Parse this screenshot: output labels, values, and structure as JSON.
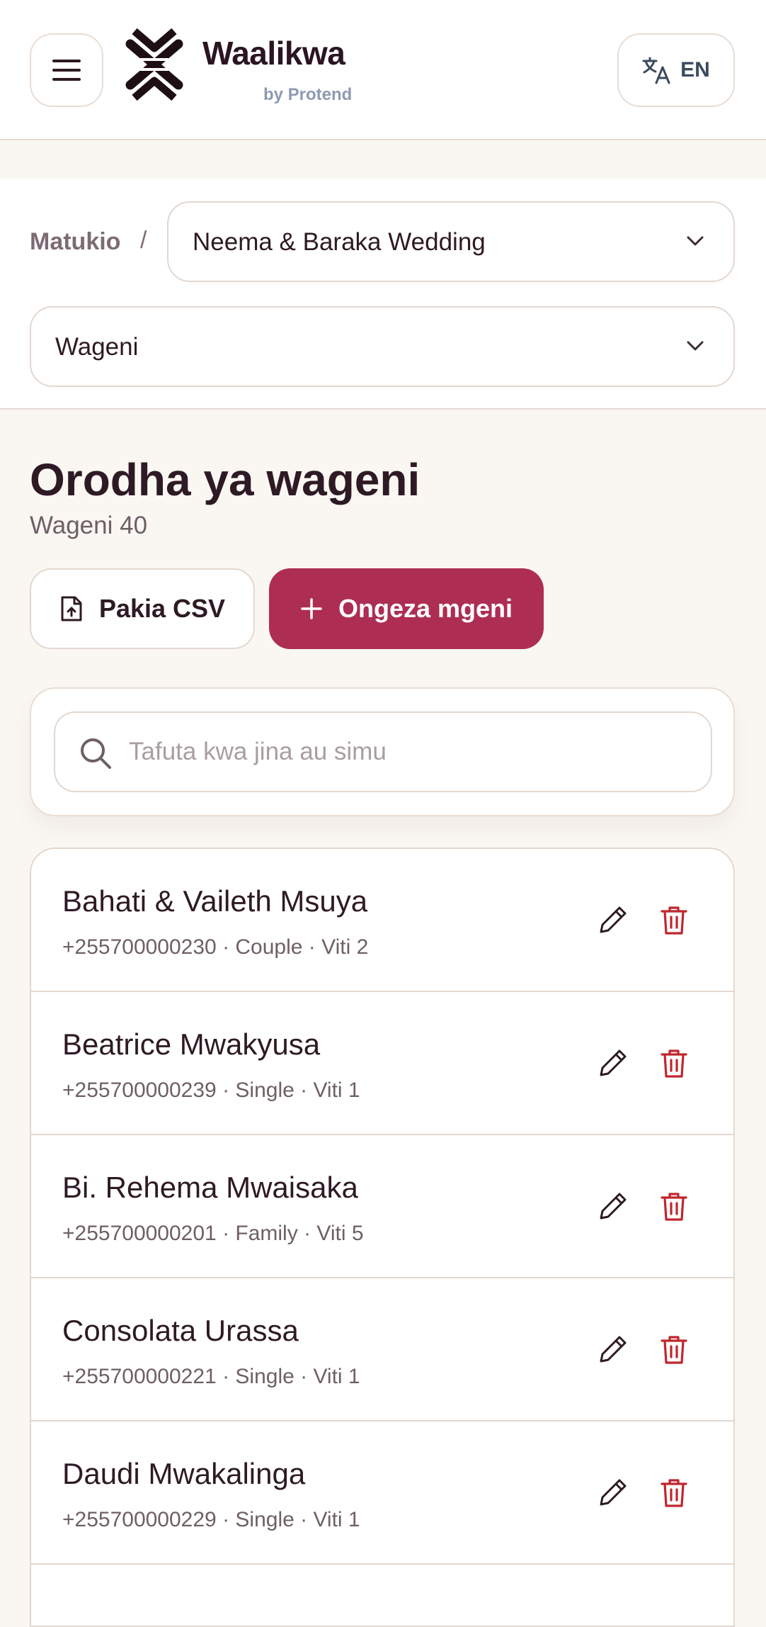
{
  "header": {
    "brand_name": "Waalikwa",
    "brand_sub": "by Protend",
    "language": "EN"
  },
  "breadcrumb": {
    "root": "Matukio",
    "separator": "/",
    "event": "Neema & Baraka Wedding"
  },
  "section_select": "Wageni",
  "page": {
    "title": "Orodha ya wageni",
    "count": "Wageni 40"
  },
  "actions": {
    "upload_csv": "Pakia CSV",
    "add_guest": "Ongeza mgeni"
  },
  "search": {
    "placeholder": "Tafuta kwa jina au simu",
    "value": ""
  },
  "guests": [
    {
      "name": "Bahati & Vaileth Msuya",
      "meta": "+255700000230 · Couple · Viti 2"
    },
    {
      "name": "Beatrice Mwakyusa",
      "meta": "+255700000239 · Single · Viti 1"
    },
    {
      "name": "Bi. Rehema Mwaisaka",
      "meta": "+255700000201 · Family · Viti 5"
    },
    {
      "name": "Consolata Urassa",
      "meta": "+255700000221 · Single · Viti 1"
    },
    {
      "name": "Daudi Mwakalinga",
      "meta": "+255700000229 · Single · Viti 1"
    }
  ],
  "colors": {
    "accent": "#ae2d52",
    "delete": "#c0262d",
    "background": "#faf7f3"
  },
  "icons": {
    "menu": "hamburger-icon",
    "logo": "waalikwa-logo",
    "language": "translate-icon",
    "chevron": "chevron-down-icon",
    "upload": "file-upload-icon",
    "add": "plus-icon",
    "search": "search-icon",
    "edit": "pencil-icon",
    "delete": "trash-icon"
  }
}
